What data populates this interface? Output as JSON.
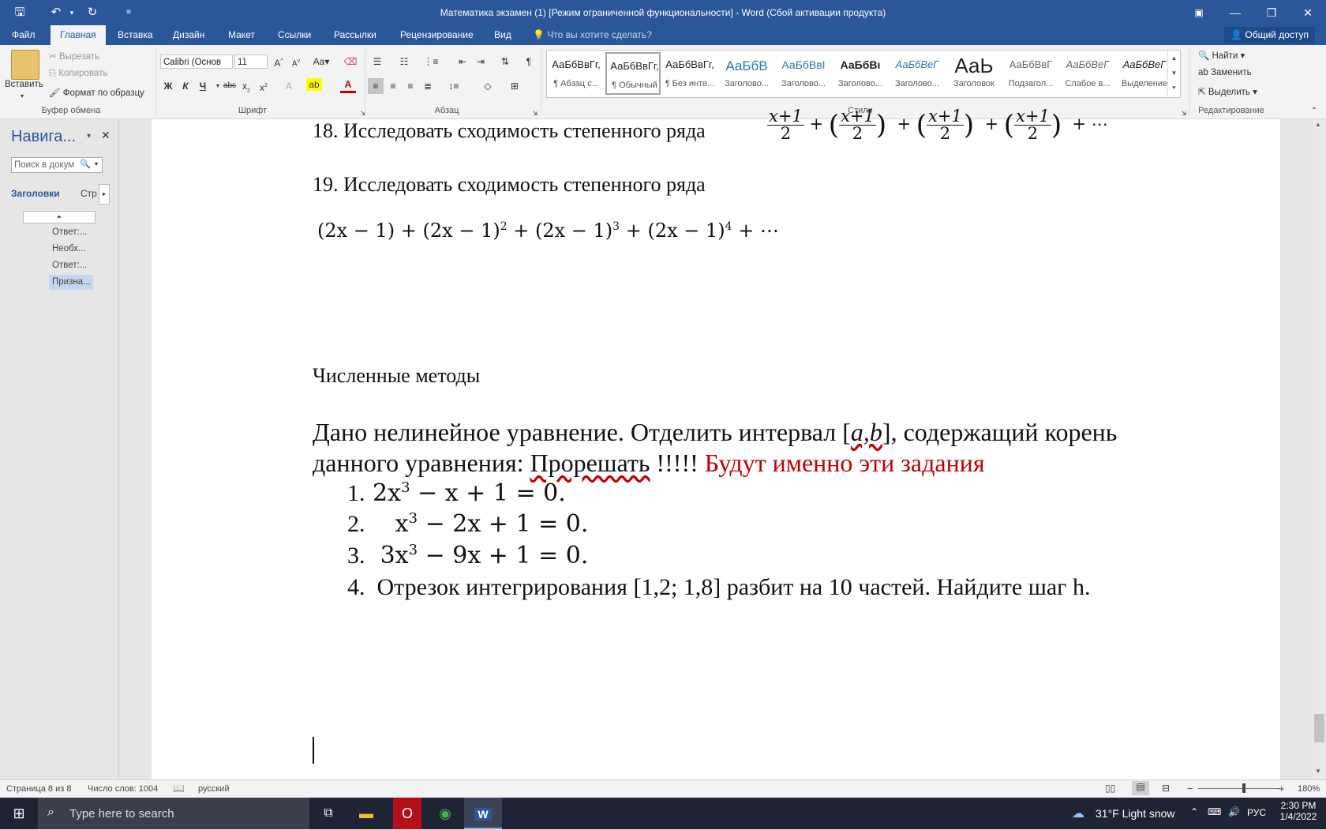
{
  "window": {
    "title": "Математика экзамен (1) [Режим ограниченной функциональности] - Word (Сбой активации продукта)"
  },
  "tabs": [
    "Файл",
    "Главная",
    "Вставка",
    "Дизайн",
    "Макет",
    "Ссылки",
    "Рассылки",
    "Рецензирование",
    "Вид"
  ],
  "tell_me": "Что вы хотите сделать?",
  "share": "Общий доступ",
  "ribbon": {
    "clipboard": {
      "paste": "Вставить",
      "cut": "Вырезать",
      "copy": "Копировать",
      "format_painter": "Формат по образцу",
      "label": "Буфер обмена"
    },
    "font": {
      "name": "Calibri (Основ",
      "size": "11",
      "label": "Шрифт",
      "bold": "Ж",
      "italic": "К",
      "underline": "Ч",
      "strike": "abc"
    },
    "paragraph": {
      "label": "Абзац"
    },
    "styles": {
      "label": "Стили",
      "items": [
        {
          "preview": "АаБбВвГг,",
          "name": "¶ Абзац с..."
        },
        {
          "preview": "АаБбВвГг,",
          "name": "¶ Обычный"
        },
        {
          "preview": "АаБбВвГг,",
          "name": "¶ Без инте..."
        },
        {
          "preview": "АаБбВ",
          "name": "Заголово..."
        },
        {
          "preview": "АаБбВвІ",
          "name": "Заголово..."
        },
        {
          "preview": "АаБбВı",
          "name": "Заголово..."
        },
        {
          "preview": "АаБбВеГ",
          "name": "Заголово..."
        },
        {
          "preview": "АаЬ",
          "name": "Заголовок"
        },
        {
          "preview": "АаБбВвГ",
          "name": "Подзагол..."
        },
        {
          "preview": "АаБбВеГ",
          "name": "Слабое в..."
        },
        {
          "preview": "АаБбВеГ",
          "name": "Выделение"
        }
      ]
    },
    "editing": {
      "find": "Найти",
      "replace": "Заменить",
      "select": "Выделить",
      "label": "Редактирование"
    }
  },
  "nav": {
    "title": "Навига...",
    "search_placeholder": "Поиск в докум",
    "tab_headings": "Заголовки",
    "tab_pages": "Стр",
    "items": [
      "Ответ:...",
      "Необх...",
      "Ответ:...",
      "Призна..."
    ]
  },
  "doc": {
    "line18_prefix": "18. Исследовать сходимость степенного  ряда",
    "frac_num": "x+1",
    "frac_den": "2",
    "plus": "+",
    "dots": "+ ⋯",
    "line19": "19. Исследовать сходимость степенного  ряда",
    "series19": [
      "(2x − 1) + (2x − 1)",
      "2",
      " +  (2x − 1)",
      "3",
      " + (2x − 1)",
      "4",
      " + ⋯"
    ],
    "section_title": "Численные методы",
    "para1_a": "Дано нелинейное уравнение. Отделить интервал [",
    "para1_ab": "a,b",
    "para1_b": "], содержащий корень",
    "para2_a": "данного уравнения: ",
    "para2_b": "Прорешать",
    "para2_c": " !!!!! ",
    "para2_red": "Будут именно эти задания",
    "items": [
      {
        "num": "1.",
        "a": "2x",
        "sup": "3",
        "b": " − x + 1 = 0."
      },
      {
        "num": "2.",
        "a": "x",
        "sup": "3",
        "b": " − 2x + 1 = 0."
      },
      {
        "num": "3.",
        "a": "3x",
        "sup": "3",
        "b": " − 9x + 1 = 0."
      }
    ],
    "item4_num": "4.",
    "item4_text": "Отрезок интегрирования [1,2; 1,8] разбит на 10 частей. Найдите шаг h."
  },
  "status": {
    "page": "Страница 8 из 8",
    "words": "Число слов: 1004",
    "lang": "русский",
    "zoom": "180%"
  },
  "taskbar": {
    "search": "Type here to search",
    "weather": "31°F  Light snow",
    "lang": "РУС",
    "time": "2:30 PM",
    "date": "1/4/2022"
  },
  "colors": {
    "accent": "#2b579a",
    "red_text": "#c00000"
  }
}
